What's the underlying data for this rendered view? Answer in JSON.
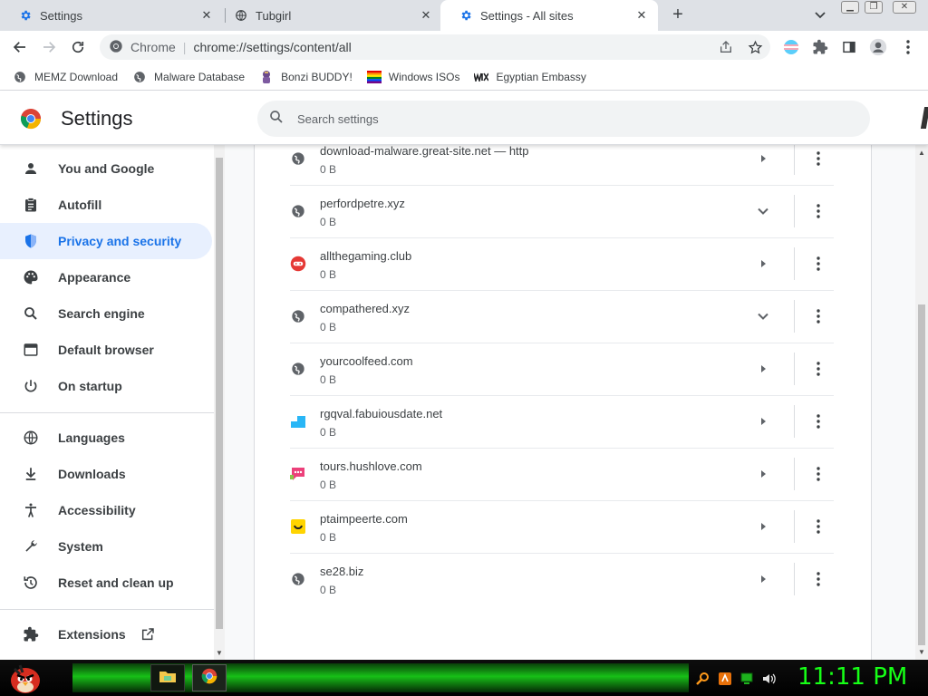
{
  "browser": {
    "tabs": [
      {
        "title": "Settings",
        "icon": "gear-icon"
      },
      {
        "title": "Tubgirl",
        "icon": "globe-icon"
      },
      {
        "title": "Settings - All sites",
        "icon": "gear-icon",
        "active": true
      }
    ],
    "omnibox": {
      "site_label": "Chrome",
      "url": "chrome://settings/content/all"
    },
    "bookmarks": [
      {
        "label": "MEMZ Download",
        "icon": "globe-icon"
      },
      {
        "label": "Malware Database",
        "icon": "globe-icon"
      },
      {
        "label": "Bonzi BUDDY!",
        "icon": "bonzi-icon"
      },
      {
        "label": "Windows ISOs",
        "icon": "rainbow-flag-icon"
      },
      {
        "label": "Egyptian Embassy",
        "icon": "wix-icon"
      }
    ]
  },
  "settings": {
    "title": "Settings",
    "search_placeholder": "Search settings",
    "nav": [
      {
        "label": "You and Google",
        "icon": "person-icon"
      },
      {
        "label": "Autofill",
        "icon": "clipboard-icon"
      },
      {
        "label": "Privacy and security",
        "icon": "shield-icon",
        "active": true
      },
      {
        "label": "Appearance",
        "icon": "palette-icon"
      },
      {
        "label": "Search engine",
        "icon": "search-icon"
      },
      {
        "label": "Default browser",
        "icon": "browser-icon"
      },
      {
        "label": "On startup",
        "icon": "power-icon"
      },
      {
        "label": "Languages",
        "icon": "globe-icon"
      },
      {
        "label": "Downloads",
        "icon": "download-icon"
      },
      {
        "label": "Accessibility",
        "icon": "accessibility-icon"
      },
      {
        "label": "System",
        "icon": "wrench-icon"
      },
      {
        "label": "Reset and clean up",
        "icon": "history-icon"
      },
      {
        "label": "Extensions",
        "icon": "puzzle-icon"
      }
    ],
    "sites": [
      {
        "name": "download-malware.great-site.net — http",
        "usage": "0 B",
        "icon": "globe-icon",
        "expand": "arrow-right"
      },
      {
        "name": "perfordpetre.xyz",
        "usage": "0 B",
        "icon": "globe-icon",
        "expand": "chevron-down"
      },
      {
        "name": "allthegaming.club",
        "usage": "0 B",
        "icon": "gamepad-icon",
        "expand": "arrow-right"
      },
      {
        "name": "compathered.xyz",
        "usage": "0 B",
        "icon": "globe-icon",
        "expand": "chevron-down"
      },
      {
        "name": "yourcoolfeed.com",
        "usage": "0 B",
        "icon": "globe-icon",
        "expand": "arrow-right"
      },
      {
        "name": "rgqval.fabuiousdate.net",
        "usage": "0 B",
        "icon": "cyan-square-icon",
        "expand": "arrow-right"
      },
      {
        "name": "tours.hushlove.com",
        "usage": "0 B",
        "icon": "chat-bubble-icon",
        "expand": "arrow-right"
      },
      {
        "name": "ptaimpeerte.com",
        "usage": "0 B",
        "icon": "smile-icon",
        "expand": "arrow-right"
      },
      {
        "name": "se28.biz",
        "usage": "0 B",
        "icon": "globe-icon",
        "expand": "arrow-right"
      }
    ]
  },
  "taskbar": {
    "clock": "11:11 PM"
  },
  "colors": {
    "accent": "#1a73e8",
    "active_nav_bg": "#e8f0fe",
    "clock": "#16ff16"
  }
}
